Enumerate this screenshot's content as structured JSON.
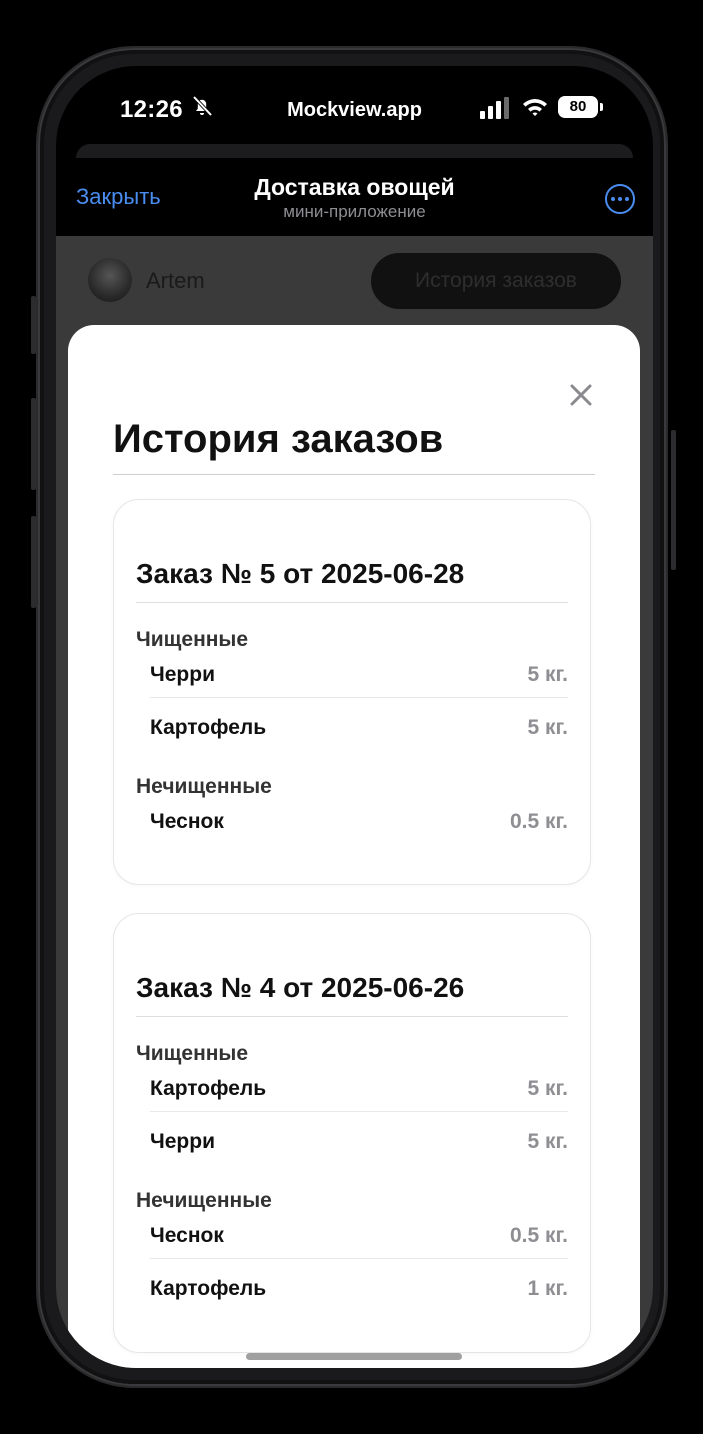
{
  "status": {
    "time": "12:26",
    "site": "Mockview.app",
    "battery": "80"
  },
  "nav": {
    "close_label": "Закрыть",
    "title": "Доставка овощей",
    "subtitle": "мини-приложение"
  },
  "profile": {
    "username": "Artem",
    "history_button": "История заказов"
  },
  "modal": {
    "title": "История заказов",
    "orders": [
      {
        "title": "Заказ № 5 от 2025-06-28",
        "groups": [
          {
            "label": "Чищенные",
            "items": [
              {
                "name": "Черри",
                "qty": "5 кг."
              },
              {
                "name": "Картофель",
                "qty": "5 кг."
              }
            ]
          },
          {
            "label": "Нечищенные",
            "items": [
              {
                "name": "Чеснок",
                "qty": "0.5 кг."
              }
            ]
          }
        ]
      },
      {
        "title": "Заказ № 4 от 2025-06-26",
        "groups": [
          {
            "label": "Чищенные",
            "items": [
              {
                "name": "Картофель",
                "qty": "5 кг."
              },
              {
                "name": "Черри",
                "qty": "5 кг."
              }
            ]
          },
          {
            "label": "Нечищенные",
            "items": [
              {
                "name": "Чеснок",
                "qty": "0.5 кг."
              },
              {
                "name": "Картофель",
                "qty": "1 кг."
              }
            ]
          }
        ]
      }
    ]
  },
  "colors": {
    "accent": "#4a8df0",
    "muted": "#8e8e93"
  }
}
